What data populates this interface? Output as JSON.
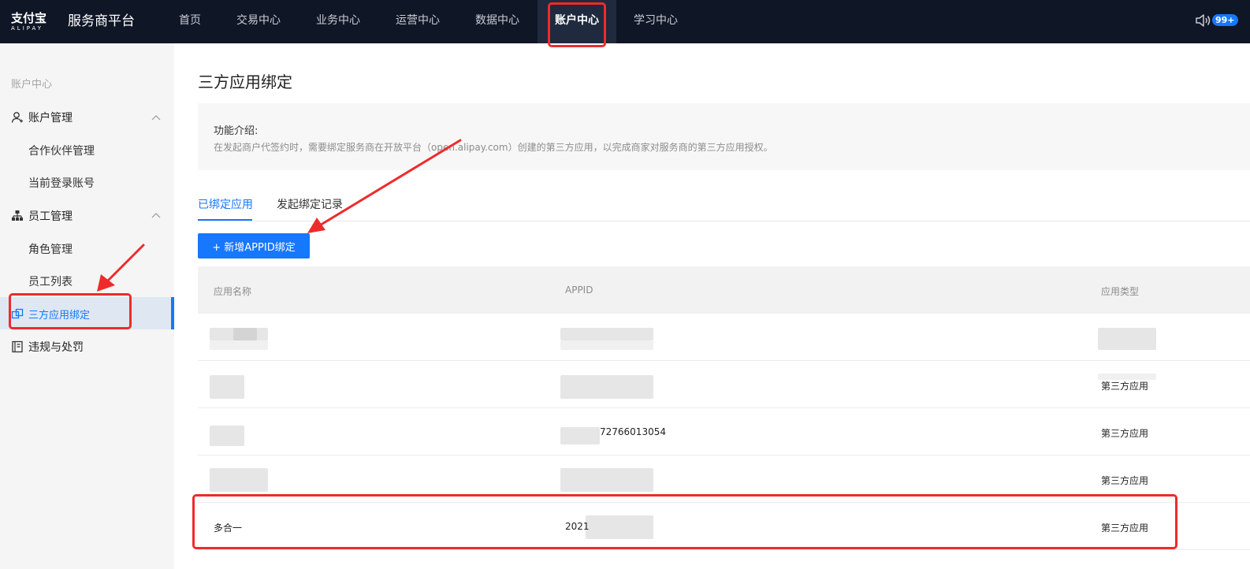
{
  "header": {
    "logo_main": "支付宝",
    "logo_sub": "ALIPAY",
    "platform_title": "服务商平台",
    "nav": [
      "首页",
      "交易中心",
      "业务中心",
      "运营中心",
      "数据中心",
      "账户中心",
      "学习中心"
    ],
    "active_nav": "账户中心",
    "notification_badge": "99+"
  },
  "sidebar": {
    "heading": "账户中心",
    "group_account": "账户管理",
    "item_partner": "合作伙伴管理",
    "item_current_account": "当前登录账号",
    "group_staff": "员工管理",
    "item_role": "角色管理",
    "item_staff_list": "员工列表",
    "item_third_party": "三方应用绑定",
    "item_violation": "违规与处罚"
  },
  "main": {
    "page_title": "三方应用绑定",
    "intro_title": "功能介绍:",
    "intro_desc": "在发起商户代签约时，需要绑定服务商在开放平台（open.alipay.com）创建的第三方应用，以完成商家对服务商的第三方应用授权。",
    "tabs": [
      "已绑定应用",
      "发起绑定记录"
    ],
    "add_button": "+ 新增APPID绑定",
    "table": {
      "headers": [
        "应用名称",
        "APPID",
        "应用类型"
      ],
      "rows": [
        {
          "name": "",
          "appid": "",
          "type": ""
        },
        {
          "name": "",
          "appid": "",
          "type": "第三方应用"
        },
        {
          "name": "",
          "appid": "72766013054",
          "type": "第三方应用"
        },
        {
          "name": "",
          "appid": "",
          "type": "第三方应用"
        },
        {
          "name": "多合一",
          "appid": "2021",
          "type": "第三方应用"
        }
      ]
    }
  },
  "colors": {
    "topbar_bg": "#0f1626",
    "accent_blue": "#1677ff",
    "annotation_red": "#ee2b2b"
  }
}
